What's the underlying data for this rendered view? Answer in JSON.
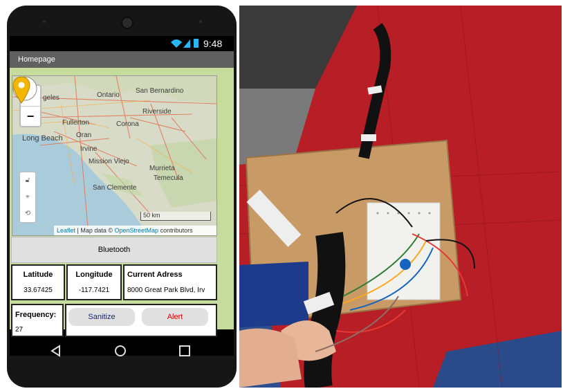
{
  "status_bar": {
    "time": "9:48"
  },
  "app": {
    "title": "Homepage",
    "map": {
      "places": [
        "Los Angeles",
        "Ontario",
        "San Bernardino",
        "Riverside",
        "Fullerton",
        "Corona",
        "Orange",
        "Long Beach",
        "Irvine",
        "Mission Viejo",
        "Murrieta",
        "Temecula",
        "San Clemente"
      ],
      "places_display": [
        "geles",
        "Ontario",
        "San Bernardino",
        "Riverside",
        "Fullerton",
        "Corona",
        "Oran",
        "Long Beach",
        "Irvine",
        "Mission Viejo",
        "Murrieta",
        "Temecula",
        "San Clemente"
      ],
      "zoom_in": "+",
      "zoom_out": "−",
      "scale": "50 km",
      "attribution_leaflet": "Leaflet",
      "attribution_mid": " | Map data © ",
      "attribution_osm": "OpenStreetMap",
      "attribution_end": " contributors"
    },
    "bluetooth_button": "Bluetooth",
    "latitude": {
      "label": "Latitude",
      "value": "33.67425"
    },
    "longitude": {
      "label": "Longitude",
      "value": "-117.7421"
    },
    "address": {
      "label": "Current Adress",
      "value": "8000 Great Park Blvd, Irv"
    },
    "frequency": {
      "label": "Frequency:",
      "value": "27"
    },
    "sanitize_button": "Sanitize",
    "alert_button": "Alert"
  },
  "colors": {
    "titlebar": "#606060",
    "app_background": "#c5dc9c",
    "alert_text": "#d50000",
    "sanitize_text": "#1a237e",
    "carpet": "#b71e26",
    "marker": "#f2b600"
  }
}
